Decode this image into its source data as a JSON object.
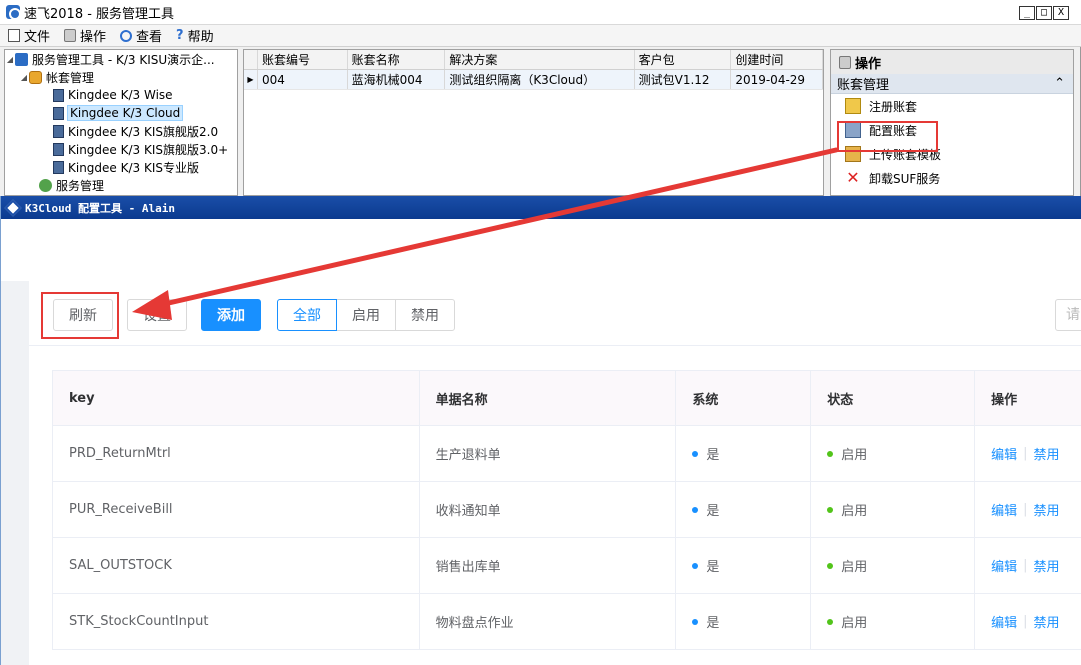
{
  "top_window": {
    "title": "速飞2018 - 服务管理工具",
    "window_controls": [
      "_",
      "□",
      "X"
    ],
    "menu": [
      {
        "label": "文件",
        "icon": "file-icon"
      },
      {
        "label": "操作",
        "icon": "action-icon"
      },
      {
        "label": "查看",
        "icon": "view-icon"
      },
      {
        "label": "帮助",
        "icon": "help-icon"
      }
    ],
    "tree": {
      "root": "服务管理工具 - K/3 KISU演示企...",
      "account_mgmt": "帐套管理",
      "products": [
        "Kingdee K/3 Wise",
        "Kingdee K/3 Cloud",
        "Kingdee K/3 KIS旗舰版2.0",
        "Kingdee K/3 KIS旗舰版3.0+",
        "Kingdee K/3 KIS专业版"
      ],
      "selected_product": "Kingdee K/3 Cloud",
      "service_mgmt": "服务管理"
    },
    "grid": {
      "columns": [
        "账套编号",
        "账套名称",
        "解决方案",
        "客户包",
        "创建时间"
      ],
      "rows": [
        [
          "004",
          "蓝海机械004",
          "测试组织隔离（K3Cloud）",
          "测试包V1.12",
          "2019-04-29"
        ]
      ]
    },
    "actions_panel": {
      "header": "操作",
      "section": "账套管理",
      "collapse_glyph": "⌃",
      "items": [
        {
          "label": "注册账套",
          "icon": "register-account-icon"
        },
        {
          "label": "配置账套",
          "icon": "configure-account-icon"
        },
        {
          "label": "上传账套模板",
          "icon": "upload-template-icon"
        },
        {
          "label": "卸载SUF服务",
          "icon": "uninstall-icon"
        }
      ]
    }
  },
  "bottom_window": {
    "title": "K3Cloud 配置工具 - Alain",
    "toolbar": {
      "refresh": "刷新",
      "settings": "设置",
      "add": "添加",
      "filters": [
        "全部",
        "启用",
        "禁用"
      ],
      "active_filter": "全部",
      "search_placeholder": "请"
    },
    "table": {
      "columns": [
        "key",
        "单据名称",
        "系统",
        "状态",
        "操作"
      ],
      "rows": [
        {
          "key": "PRD_ReturnMtrl",
          "name": "生产退料单",
          "system": "是",
          "status": "启用",
          "edit": "编辑",
          "disable": "禁用"
        },
        {
          "key": "PUR_ReceiveBill",
          "name": "收料通知单",
          "system": "是",
          "status": "启用",
          "edit": "编辑",
          "disable": "禁用"
        },
        {
          "key": "SAL_OUTSTOCK",
          "name": "销售出库单",
          "system": "是",
          "status": "启用",
          "edit": "编辑",
          "disable": "禁用"
        },
        {
          "key": "STK_StockCountInput",
          "name": "物料盘点作业",
          "system": "是",
          "status": "启用",
          "edit": "编辑",
          "disable": "禁用"
        }
      ]
    }
  },
  "colors": {
    "highlight": "#e53935",
    "primary": "#1890ff",
    "status_enabled": "#52c41a",
    "title_bar": "#1a4ea8"
  }
}
